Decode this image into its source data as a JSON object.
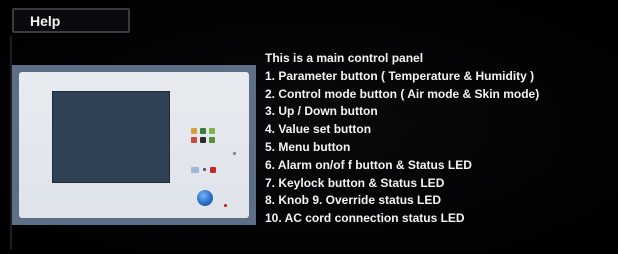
{
  "header": {
    "tab_label": "Help"
  },
  "illustration": {
    "icon": "control-panel-image"
  },
  "content": {
    "title": "This is a main control panel",
    "items": [
      "1. Parameter button ( Temperature & Humidity )",
      "2. Control mode button ( Air mode & Skin mode)",
      "3. Up / Down button",
      "4. Value set button",
      "5. Menu button",
      "6. Alarm on/of f button & Status LED",
      "7. Keylock button & Status LED",
      "8. Knob  9. Override status LED",
      "10. AC cord connection status LED"
    ]
  },
  "colors": {
    "background": "#000000",
    "text": "#f3f3f3",
    "panel_border": "#5c6f86",
    "lcd": "#2f4152"
  }
}
